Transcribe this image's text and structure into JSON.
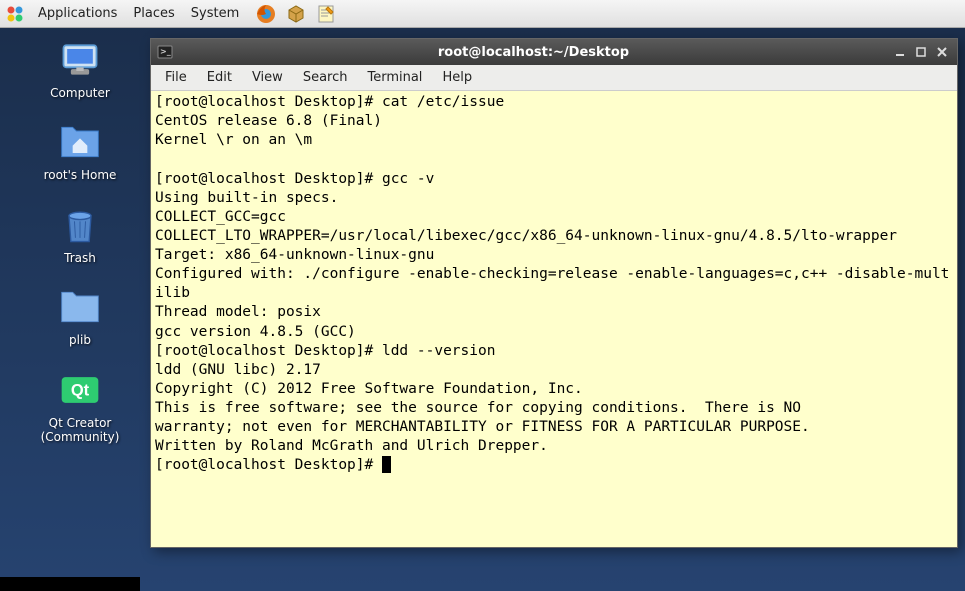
{
  "panel": {
    "menus": [
      "Applications",
      "Places",
      "System"
    ],
    "tray_icons": [
      "firefox-icon",
      "package-icon",
      "notepad-icon"
    ]
  },
  "desktop": {
    "icons": [
      {
        "name": "computer-icon",
        "label": "Computer"
      },
      {
        "name": "home-folder-icon",
        "label": "root's Home"
      },
      {
        "name": "trash-icon",
        "label": "Trash"
      },
      {
        "name": "folder-icon",
        "label": "plib"
      },
      {
        "name": "qt-creator-icon",
        "label": "Qt Creator\n(Community)"
      }
    ]
  },
  "window": {
    "title": "root@localhost:~/Desktop",
    "menus": [
      "File",
      "Edit",
      "View",
      "Search",
      "Terminal",
      "Help"
    ],
    "terminal_lines": [
      "[root@localhost Desktop]# cat /etc/issue",
      "CentOS release 6.8 (Final)",
      "Kernel \\r on an \\m",
      "",
      "[root@localhost Desktop]# gcc -v",
      "Using built-in specs.",
      "COLLECT_GCC=gcc",
      "COLLECT_LTO_WRAPPER=/usr/local/libexec/gcc/x86_64-unknown-linux-gnu/4.8.5/lto-wrapper",
      "Target: x86_64-unknown-linux-gnu",
      "Configured with: ./configure -enable-checking=release -enable-languages=c,c++ -disable-multilib",
      "Thread model: posix",
      "gcc version 4.8.5 (GCC)",
      "[root@localhost Desktop]# ldd --version",
      "ldd (GNU libc) 2.17",
      "Copyright (C) 2012 Free Software Foundation, Inc.",
      "This is free software; see the source for copying conditions.  There is NO",
      "warranty; not even for MERCHANTABILITY or FITNESS FOR A PARTICULAR PURPOSE.",
      "Written by Roland McGrath and Ulrich Drepper.",
      "[root@localhost Desktop]# "
    ]
  }
}
